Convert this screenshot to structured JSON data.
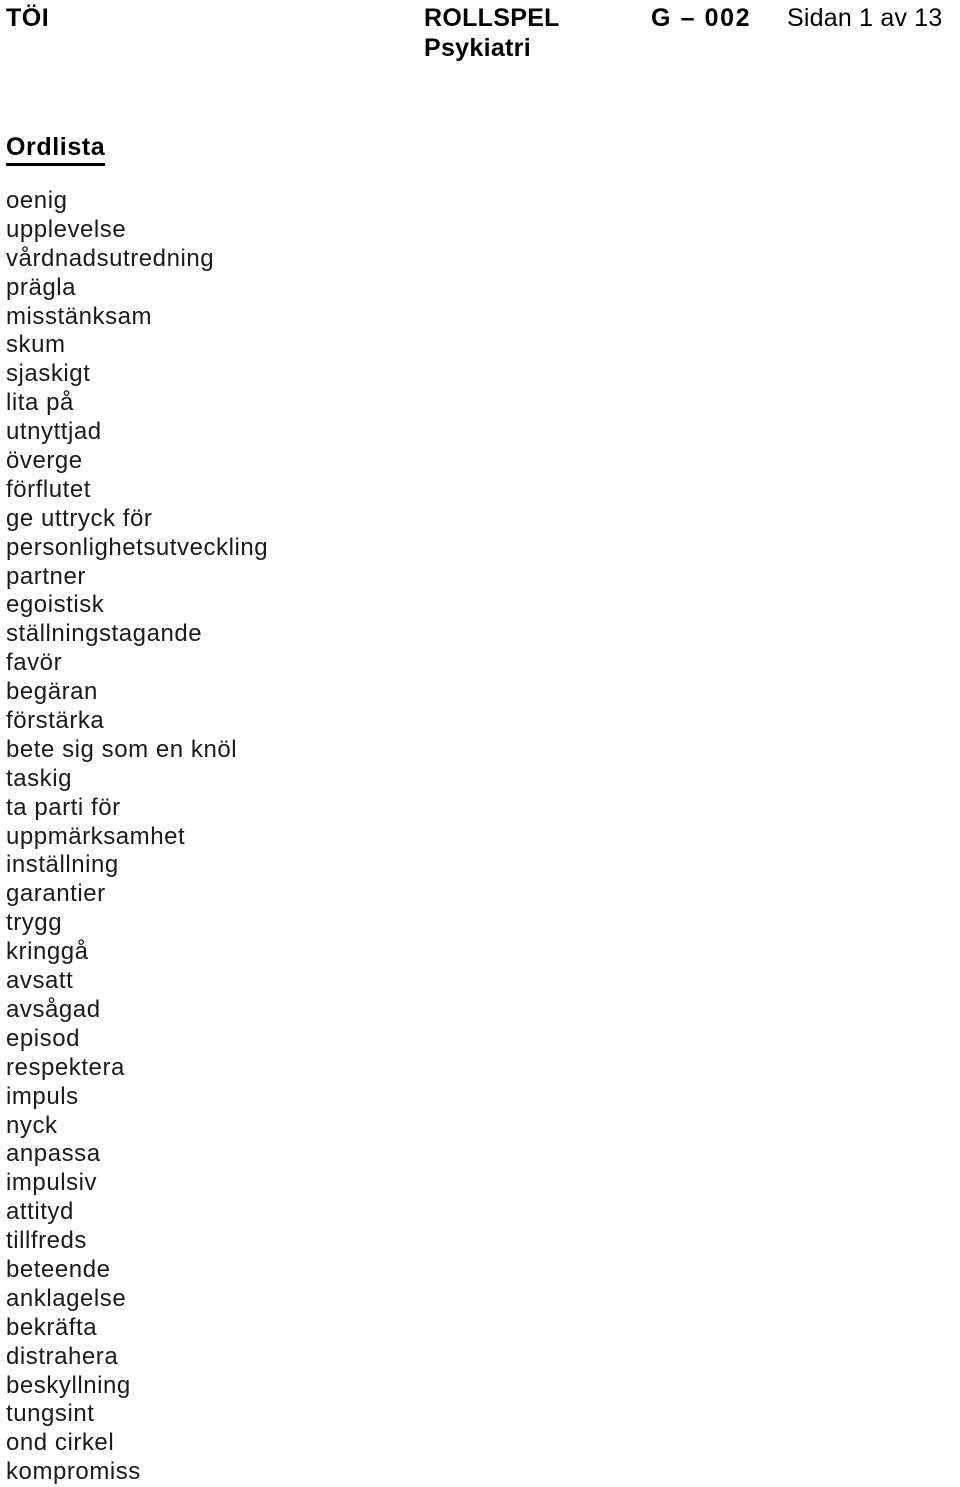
{
  "header": {
    "organization": "TÖI",
    "document_kind": "ROLLSPEL",
    "subject": "Psykiatri",
    "document_code": "G – 002",
    "page_indicator": "Sidan 1 av 13"
  },
  "section": {
    "heading": "Ordlista"
  },
  "glossary": {
    "items": [
      "oenig",
      "upplevelse",
      "vårdnadsutredning",
      "prägla",
      "misstänksam",
      "skum",
      "sjaskigt",
      "lita på",
      "utnyttjad",
      "överge",
      "förflutet",
      "ge uttryck för",
      "personlighetsutveckling",
      "partner",
      "egoistisk",
      "ställningstagande",
      "favör",
      "begäran",
      "förstärka",
      "bete sig som en knöl",
      "taskig",
      "ta parti för",
      "uppmärksamhet",
      "inställning",
      "garantier",
      "trygg",
      "kringgå",
      "avsatt",
      "avsågad",
      "episod",
      "respektera",
      "impuls",
      "nyck",
      "anpassa",
      "impulsiv",
      "attityd",
      "tillfreds",
      "beteende",
      "anklagelse",
      "bekräfta",
      "distrahera",
      "beskyllning",
      "tungsint",
      "ond cirkel",
      "kompromiss"
    ]
  },
  "colors": {
    "page_background": "#ffffff",
    "text": "#000000",
    "list_text": "#1a1a1a"
  }
}
